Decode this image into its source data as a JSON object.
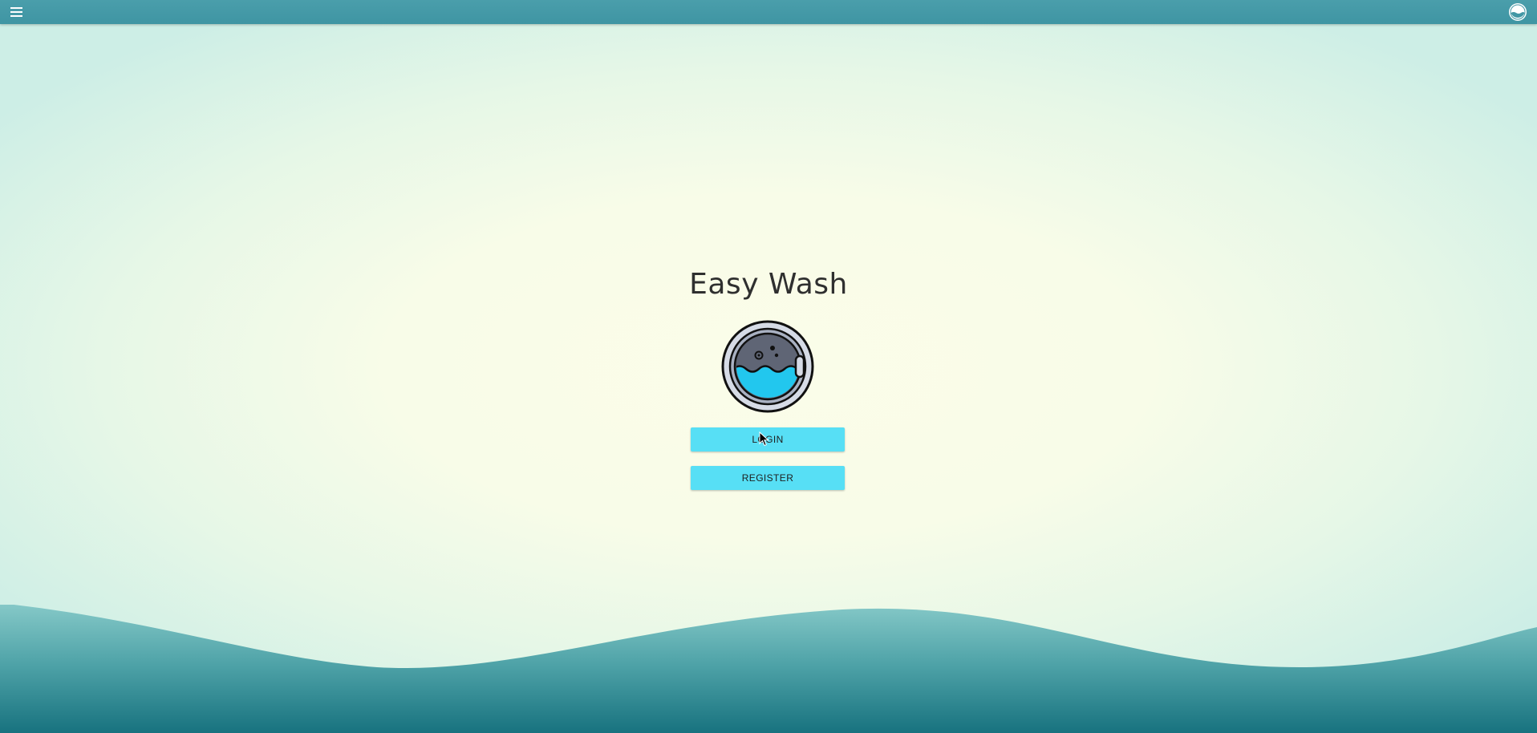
{
  "app": {
    "title": "Easy Wash"
  },
  "topbar": {
    "menu_icon": "hamburger-menu-icon",
    "logo_icon": "washer-logo-icon",
    "bg_color": "#4297a5"
  },
  "main": {
    "logo_icon": "washing-machine-icon",
    "login_label": "LOGIN",
    "register_label": "REGISTER",
    "button_color": "#57dff5"
  },
  "colors": {
    "wave": "#2e8a94",
    "background_center": "#fbfde9",
    "background_edge": "#cdeee6"
  }
}
